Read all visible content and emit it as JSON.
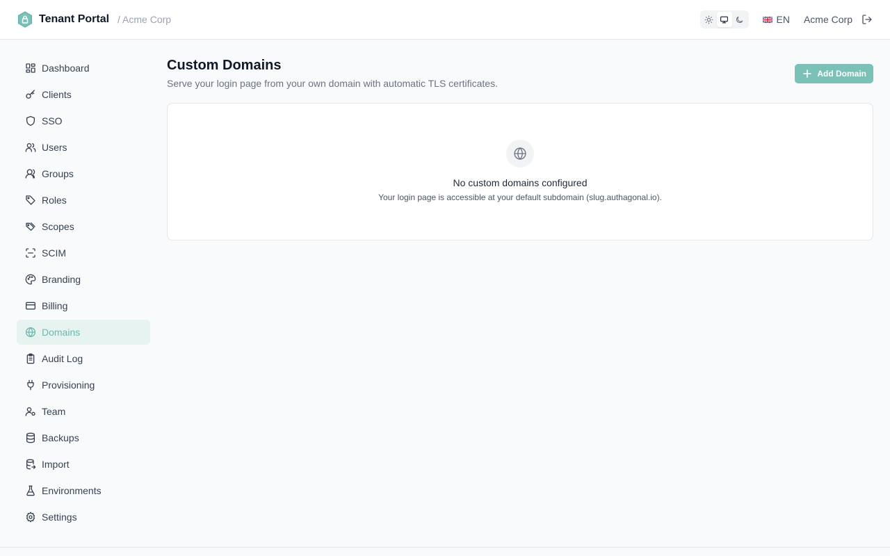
{
  "header": {
    "app_title": "Tenant Portal",
    "breadcrumb": "/ Acme Corp",
    "language": "EN",
    "org_name": "Acme Corp",
    "theme_options": [
      "light",
      "system",
      "dark"
    ],
    "active_theme": "system",
    "brand_color": "#5fb3a6"
  },
  "sidebar": {
    "items": [
      {
        "label": "Dashboard",
        "icon": "dashboard-icon"
      },
      {
        "label": "Clients",
        "icon": "key-icon"
      },
      {
        "label": "SSO",
        "icon": "shield-icon"
      },
      {
        "label": "Users",
        "icon": "users-icon"
      },
      {
        "label": "Groups",
        "icon": "group-icon"
      },
      {
        "label": "Roles",
        "icon": "tag-icon"
      },
      {
        "label": "Scopes",
        "icon": "tags-icon"
      },
      {
        "label": "SCIM",
        "icon": "scan-icon"
      },
      {
        "label": "Branding",
        "icon": "palette-icon"
      },
      {
        "label": "Billing",
        "icon": "credit-card-icon"
      },
      {
        "label": "Domains",
        "icon": "globe-icon"
      },
      {
        "label": "Audit Log",
        "icon": "clipboard-icon"
      },
      {
        "label": "Provisioning",
        "icon": "plug-icon"
      },
      {
        "label": "Team",
        "icon": "user-cog-icon"
      },
      {
        "label": "Backups",
        "icon": "database-icon"
      },
      {
        "label": "Import",
        "icon": "database-import-icon"
      },
      {
        "label": "Environments",
        "icon": "flask-icon"
      },
      {
        "label": "Settings",
        "icon": "gear-icon"
      }
    ],
    "active": "Domains",
    "active_color": "#6bb8ae"
  },
  "main": {
    "title": "Custom Domains",
    "subtitle": "Serve your login page from your own domain with automatic TLS certificates.",
    "add_button_label": "Add Domain",
    "empty_state": {
      "title": "No custom domains configured",
      "description": "Your login page is accessible at your default subdomain (slug.authagonal.io).",
      "icon": "globe-icon"
    }
  }
}
